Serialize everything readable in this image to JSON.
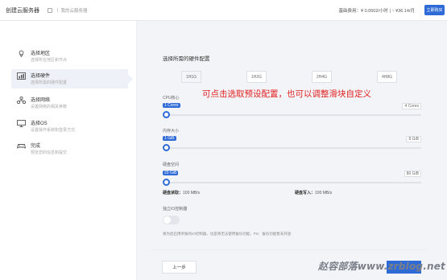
{
  "header": {
    "app_title": "创建云服务器",
    "breadcrumb": "我的云服务器",
    "base_price_label": "基础费用：",
    "base_price_value": "¥ 0.0502/小时 | ~ ¥36.14/月",
    "order_button": "立即购买"
  },
  "sidebar": {
    "steps": [
      {
        "title": "选择地区",
        "subtitle": "选择所在地区和节点",
        "icon": "location-pin-icon",
        "active": false
      },
      {
        "title": "选择硬件",
        "subtitle": "选择所需的硬件配置",
        "icon": "hardware-chart-icon",
        "active": true
      },
      {
        "title": "选择网络",
        "subtitle": "设置网络的相关参数",
        "icon": "network-icon",
        "active": false
      },
      {
        "title": "选择OS",
        "subtitle": "设置操作系统和登录方式",
        "icon": "monitor-icon",
        "active": false
      },
      {
        "title": "完成",
        "subtitle": "预览您的信息和提交",
        "icon": "gamepad-icon",
        "active": false
      }
    ]
  },
  "main": {
    "section_title": "选择所需的硬件配置",
    "presets": [
      "1H1G",
      "1H2G",
      "2H4G",
      "4H8G"
    ],
    "selected_preset": "1H1G",
    "note": "可点击选取预设配置，也可以调整滑块自定义",
    "sliders": [
      {
        "label": "CPU核心",
        "current": "1 Cores",
        "max": "4 Cores",
        "fraction": 0.0
      },
      {
        "label": "内存大小",
        "current": "1 GiB",
        "max": "8 GiB",
        "fraction": 0.0
      },
      {
        "label": "硬盘空间",
        "current": "20 GiB",
        "max": "80 GiB",
        "fraction": 0.0
      }
    ],
    "disk_read_label": "硬盘读取：",
    "disk_read_value": "100 MB/s",
    "disk_write_label": "硬盘写入：",
    "disk_write_value": "100 MB/s",
    "io_label": "独立IO控制器",
    "io_enabled": false,
    "io_description": "将为您启用单独的IO控制器，也是将无法使用备份功能，PS：备份功能暂未开放"
  },
  "footer": {
    "prev_button": "上一步",
    "watermark": "赵容部落www.zrblog.net"
  },
  "colors": {
    "accent": "#2f6bd7",
    "note": "#e02020"
  }
}
